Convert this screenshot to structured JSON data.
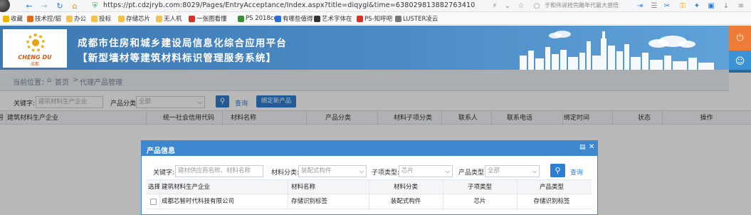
{
  "browser": {
    "url": "https://pt.cdzjryb.com:8029/Pages/EntryAcceptance/Index.aspx?title=diqygl&time=638029813882763410",
    "search_hint": "于和伟说抢完雕年代最大感悟",
    "bookmarks": [
      {
        "label": "收藏",
        "color": "#f0b400"
      },
      {
        "label": "技术控/貂",
        "color": "#e06a1b"
      },
      {
        "label": "办公",
        "color": "#f2c14e"
      },
      {
        "label": "投标",
        "color": "#f2c14e"
      },
      {
        "label": "存储芯片",
        "color": "#f2c14e"
      },
      {
        "label": "无人机",
        "color": "#f2c14e"
      },
      {
        "label": "一张图看懂",
        "color": "#d93025"
      },
      {
        "label": "PS 2018cc",
        "color": "#3a8f3a"
      },
      {
        "label": "有哪些值得",
        "color": "#2a6fd6"
      },
      {
        "label": "艺术字体在",
        "color": "#333333"
      },
      {
        "label": "PS-知呼吧",
        "color": "#d93025"
      },
      {
        "label": "LUSTER凌云",
        "color": "#777777"
      }
    ]
  },
  "header": {
    "logo_text": "CHENG DU",
    "logo_sub": "成都",
    "title_line1": "成都市住房和城乡建设局信息化综合应用平台",
    "title_line2": "【新型墙材等建筑材料标识管理服务系统】"
  },
  "breadcrumb": {
    "prefix": "当前位置：",
    "home": "首页",
    "sep": ">",
    "current": "代理产品管理"
  },
  "search": {
    "keyword_label": "关键字:",
    "keyword_placeholder": "建筑材料生产企业",
    "category_label": "产品分类:",
    "category_value": "全部",
    "query_label": "查询",
    "bind_label": "绑定新产品"
  },
  "bg_table": {
    "columns": [
      "号",
      "建筑材料生产企业",
      "统一社会信用代码",
      "材料名称",
      "产品分类",
      "材料子项分类",
      "联系人",
      "联系电话",
      "绑定时间",
      "状态",
      "操作"
    ]
  },
  "modal": {
    "title": "产品信息",
    "keyword_label": "关键字:",
    "keyword_placeholder": "建材供应商名称、材料名称",
    "material_category_label": "材料分类:",
    "material_category_value": "装配式构件",
    "subtype_label": "子项类型:",
    "subtype_value": "芯片",
    "product_type_label": "产品类型:",
    "product_type_value": "全部",
    "query_label": "查询",
    "columns": [
      "选择",
      "建筑材料生产企业",
      "材料名称",
      "材料分类",
      "子项类型",
      "产品类型"
    ],
    "rows": [
      {
        "company": "成都芯智时代科技有限公司",
        "material": "存储识别标签",
        "category": "装配式构件",
        "subtype": "芯片",
        "product_type": "存储识别标签"
      }
    ]
  }
}
